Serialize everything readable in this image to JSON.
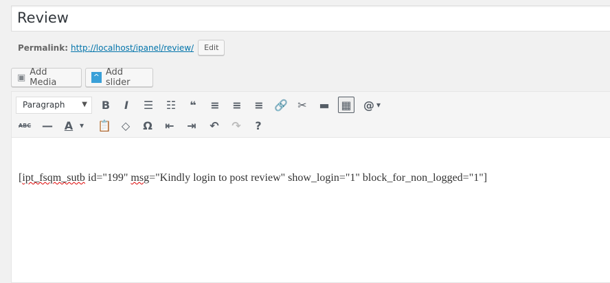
{
  "title": "Review",
  "permalink": {
    "label": "Permalink:",
    "url": "http://localhost/ipanel/review/",
    "edit": "Edit"
  },
  "media_buttons": {
    "add_media": "Add Media",
    "add_slider": "Add slider"
  },
  "toolbar": {
    "format": "Paragraph",
    "row1": [
      {
        "name": "bold",
        "glyph": "B"
      },
      {
        "name": "italic",
        "glyph": "I"
      },
      {
        "name": "bullet-list",
        "glyph": "☰"
      },
      {
        "name": "numbered-list",
        "glyph": "☷"
      },
      {
        "name": "blockquote",
        "glyph": "❝"
      },
      {
        "name": "align-left",
        "glyph": "≡"
      },
      {
        "name": "align-center",
        "glyph": "≡"
      },
      {
        "name": "align-right",
        "glyph": "≡"
      },
      {
        "name": "link",
        "glyph": "🔗"
      },
      {
        "name": "unlink",
        "glyph": "✂"
      },
      {
        "name": "read-more",
        "glyph": "▬"
      },
      {
        "name": "toolbar-toggle",
        "glyph": "▦"
      },
      {
        "name": "shortcode",
        "glyph": "@"
      },
      {
        "name": "dropdown-arrow",
        "glyph": "▾"
      }
    ],
    "row2": [
      {
        "name": "strikethrough",
        "glyph": "ABC"
      },
      {
        "name": "horizontal-line",
        "glyph": "—"
      },
      {
        "name": "text-color",
        "glyph": "A"
      },
      {
        "name": "text-color-arrow",
        "glyph": "▾"
      },
      {
        "name": "paste-text",
        "glyph": "📋"
      },
      {
        "name": "clear-formatting",
        "glyph": "◇"
      },
      {
        "name": "special-character",
        "glyph": "Ω"
      },
      {
        "name": "outdent",
        "glyph": "⇤"
      },
      {
        "name": "indent",
        "glyph": "⇥"
      },
      {
        "name": "undo",
        "glyph": "↶"
      },
      {
        "name": "redo",
        "glyph": "↷"
      },
      {
        "name": "help",
        "glyph": "?"
      }
    ]
  },
  "content": {
    "p1": "[",
    "w1": "ipt_fsqm_sutb",
    "p2": " id=\"199\" ",
    "w2": "msg",
    "p3": "=\"Kindly login to post review\" show_login=\"1\" block_for_non_logged=\"1\"]"
  }
}
